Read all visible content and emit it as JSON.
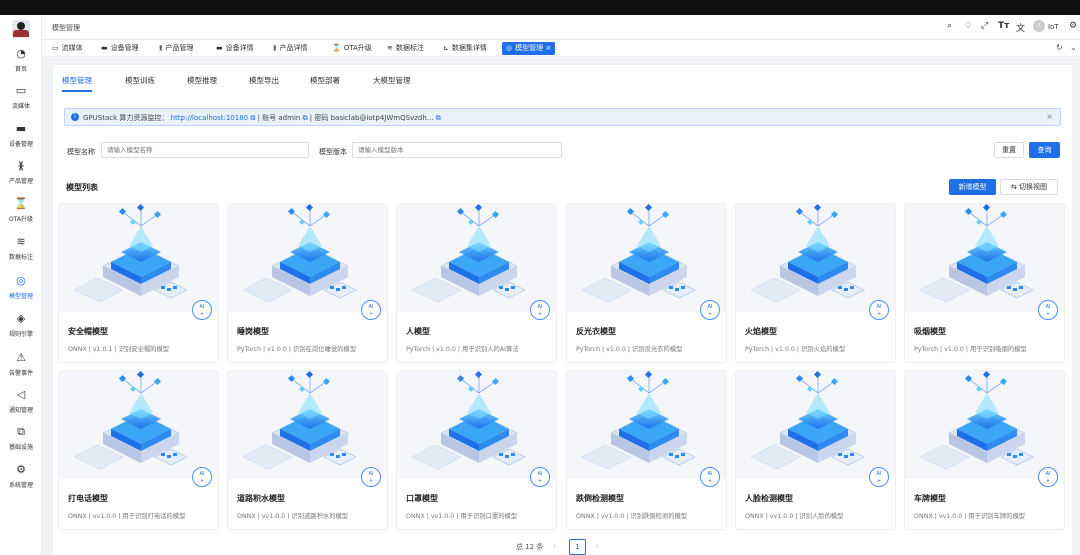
{
  "header": {
    "breadcrumb": "模型管理",
    "user": "IoT",
    "avatar_text": "I",
    "icons": [
      "search-icon",
      "bell-icon",
      "fullscreen-icon",
      "font-size-icon",
      "translate-icon"
    ]
  },
  "sidebar": {
    "items": [
      {
        "label": "首页",
        "icon": "dashboard-icon",
        "glyph": "◔"
      },
      {
        "label": "流媒体",
        "icon": "video-icon",
        "glyph": "▭"
      },
      {
        "label": "设备管理",
        "icon": "monitor-icon",
        "glyph": "▬"
      },
      {
        "label": "产品管理",
        "icon": "hierarchy-icon",
        "glyph": "ᚕ"
      },
      {
        "label": "OTA升级",
        "icon": "hourglass-icon",
        "glyph": "⌛"
      },
      {
        "label": "数据标注",
        "icon": "database-icon",
        "glyph": "≋"
      },
      {
        "label": "模型管理",
        "icon": "model-icon",
        "glyph": "◎",
        "active": true
      },
      {
        "label": "规则引擎",
        "icon": "rule-icon",
        "glyph": "◈"
      },
      {
        "label": "告警事件",
        "icon": "alarm-icon",
        "glyph": "⚠"
      },
      {
        "label": "通知管理",
        "icon": "speaker-icon",
        "glyph": "◁"
      },
      {
        "label": "基础设施",
        "icon": "copy-icon",
        "glyph": "⧉"
      },
      {
        "label": "系统管理",
        "icon": "gear-icon",
        "glyph": "⚙"
      }
    ],
    "collapse_glyph": "«"
  },
  "tabs": [
    {
      "label": "流媒体",
      "icon": "video-icon",
      "glyph": "▭"
    },
    {
      "label": "设备管理",
      "icon": "monitor-icon",
      "glyph": "▬"
    },
    {
      "label": "产品管理",
      "icon": "hierarchy-icon",
      "glyph": "ᚕ"
    },
    {
      "label": "设备详情",
      "icon": "monitor-icon",
      "glyph": "▬"
    },
    {
      "label": "产品详情",
      "icon": "hierarchy-icon",
      "glyph": "ᚕ"
    },
    {
      "label": "OTA升级",
      "icon": "hourglass-icon",
      "glyph": "⌛"
    },
    {
      "label": "数据标注",
      "icon": "database-icon",
      "glyph": "≋"
    },
    {
      "label": "数据集详情",
      "icon": "chart-icon",
      "glyph": "⊾"
    },
    {
      "label": "模型管理",
      "icon": "model-icon",
      "glyph": "◎",
      "active": true,
      "close": "×"
    }
  ],
  "subtabs": [
    "模型管理",
    "模型训练",
    "模型推理",
    "模型导出",
    "模型部署",
    "大模型管理"
  ],
  "alert": {
    "prefix": "GPUStack 算力资源监控：",
    "link": "http://localhost:10180",
    "account": "| 账号 admin",
    "password": "| 密码 basiclab@iotp4JWmQSvzdh...",
    "close": "×"
  },
  "filter": {
    "name_label": "模型名称",
    "name_placeholder": "请输入模型名称",
    "version_label": "模型版本",
    "version_placeholder": "请输入模型版本",
    "reset": "重置",
    "search": "查询"
  },
  "list": {
    "title": "模型列表",
    "add": "新增模型",
    "switch_view": "⇆ 切换视图"
  },
  "badge": {
    "top": "AI",
    "bottom": "+"
  },
  "cards": [
    {
      "name": "安全帽模型",
      "desc": "ONNX | v1.0.1 | 识别安全帽的模型"
    },
    {
      "name": "睡岗模型",
      "desc": "PyTorch | v1.0.0 | 识别在岗位睡觉的模型"
    },
    {
      "name": "人模型",
      "desc": "PyTorch | v1.0.0 | 用于识别人的AI算法"
    },
    {
      "name": "反光衣模型",
      "desc": "PyTorch | v1.0.0 | 识别反光衣的模型"
    },
    {
      "name": "火焰模型",
      "desc": "PyTorch | v1.0.0 | 识别火焰的模型"
    },
    {
      "name": "吸烟模型",
      "desc": "PyTorch | v1.0.0 | 用于识别吸烟的模型"
    },
    {
      "name": "打电话模型",
      "desc": "ONNX | vv1.0.0 | 用于识别打电话的模型"
    },
    {
      "name": "道路积水模型",
      "desc": "ONNX | vv1.0.0 | 识别道路积水的模型"
    },
    {
      "name": "口罩模型",
      "desc": "ONNX | vv1.0.0 | 用于识别口罩的模型"
    },
    {
      "name": "跌倒检测模型",
      "desc": "ONNX | vv1.0.0 | 识别跌倒检测的模型"
    },
    {
      "name": "人脸检测模型",
      "desc": "ONNX | vv1.0.0 | 识别人脸的模型"
    },
    {
      "name": "车牌模型",
      "desc": "ONNX | vv1.0.0 | 用于识别车牌的模型"
    }
  ],
  "pagination": {
    "total": "总 12 条",
    "prev": "‹",
    "page": "1",
    "next": "›"
  },
  "colors": {
    "primary": "#1e6fe8",
    "alert_bg": "#e8f1fc"
  }
}
